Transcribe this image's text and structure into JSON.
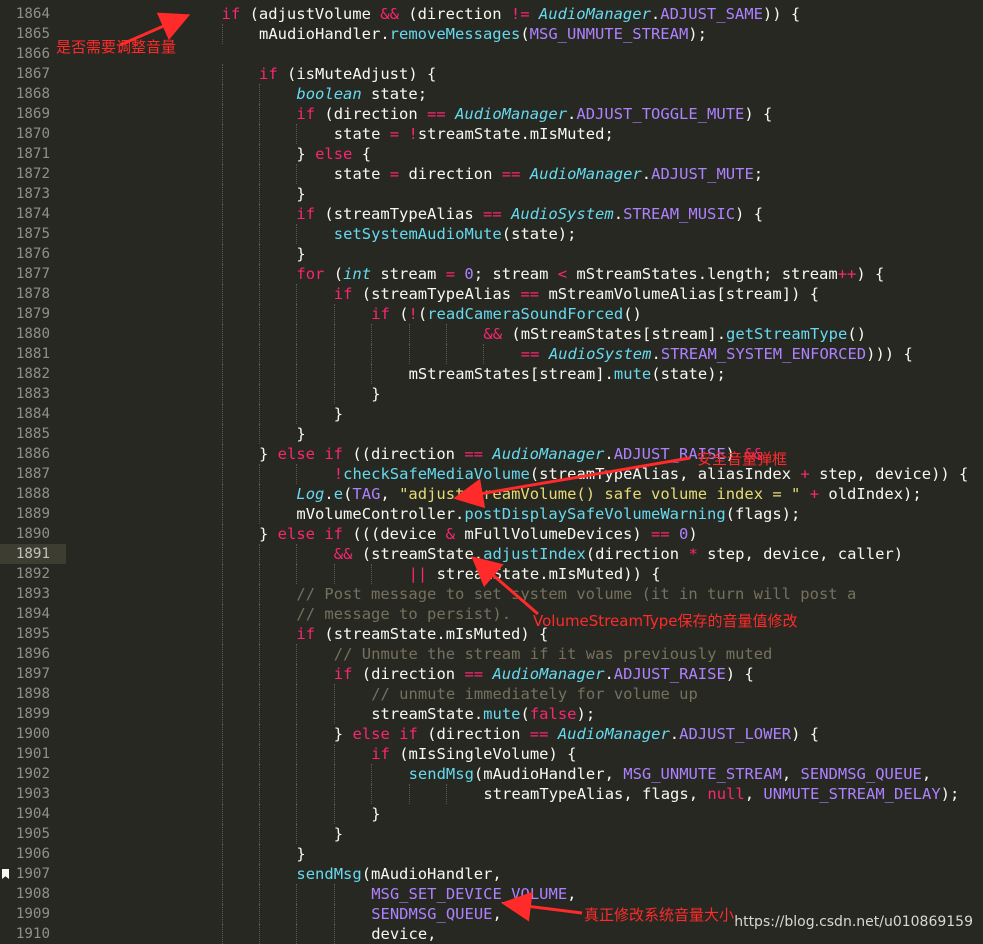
{
  "editor": {
    "theme_colors": {
      "background": "#272822",
      "keyword": "#f92672",
      "type": "#66d9ef",
      "constant": "#ae81ff",
      "string": "#e6db74",
      "comment": "#75715e",
      "annotation": "#ff2a2a"
    },
    "lines": [
      {
        "n": "1864",
        "indent": 4,
        "code": "if (adjustVolume && (direction != AudioManager.ADJUST_SAME)) {"
      },
      {
        "n": "1865",
        "indent": 5,
        "code": "mAudioHandler.removeMessages(MSG_UNMUTE_STREAM);"
      },
      {
        "n": "1866",
        "indent": 0,
        "code": ""
      },
      {
        "n": "1867",
        "indent": 5,
        "code": "if (isMuteAdjust) {"
      },
      {
        "n": "1868",
        "indent": 6,
        "code": "boolean state;"
      },
      {
        "n": "1869",
        "indent": 6,
        "code": "if (direction == AudioManager.ADJUST_TOGGLE_MUTE) {"
      },
      {
        "n": "1870",
        "indent": 7,
        "code": "state = !streamState.mIsMuted;"
      },
      {
        "n": "1871",
        "indent": 6,
        "code": "} else {"
      },
      {
        "n": "1872",
        "indent": 7,
        "code": "state = direction == AudioManager.ADJUST_MUTE;"
      },
      {
        "n": "1873",
        "indent": 6,
        "code": "}"
      },
      {
        "n": "1874",
        "indent": 6,
        "code": "if (streamTypeAlias == AudioSystem.STREAM_MUSIC) {"
      },
      {
        "n": "1875",
        "indent": 7,
        "code": "setSystemAudioMute(state);"
      },
      {
        "n": "1876",
        "indent": 6,
        "code": "}"
      },
      {
        "n": "1877",
        "indent": 6,
        "code": "for (int stream = 0; stream < mStreamStates.length; stream++) {"
      },
      {
        "n": "1878",
        "indent": 7,
        "code": "if (streamTypeAlias == mStreamVolumeAlias[stream]) {"
      },
      {
        "n": "1879",
        "indent": 8,
        "code": "if (!(readCameraSoundForced()"
      },
      {
        "n": "1880",
        "indent": 11,
        "code": "&& (mStreamStates[stream].getStreamType()"
      },
      {
        "n": "1881",
        "indent": 12,
        "code": "== AudioSystem.STREAM_SYSTEM_ENFORCED))) {"
      },
      {
        "n": "1882",
        "indent": 9,
        "code": "mStreamStates[stream].mute(state);"
      },
      {
        "n": "1883",
        "indent": 8,
        "code": "}"
      },
      {
        "n": "1884",
        "indent": 7,
        "code": "}"
      },
      {
        "n": "1885",
        "indent": 6,
        "code": "}"
      },
      {
        "n": "1886",
        "indent": 5,
        "code": "} else if ((direction == AudioManager.ADJUST_RAISE) &&"
      },
      {
        "n": "1887",
        "indent": 7,
        "code": "!checkSafeMediaVolume(streamTypeAlias, aliasIndex + step, device)) {"
      },
      {
        "n": "1888",
        "indent": 6,
        "code": "Log.e(TAG, \"adjustStreamVolume() safe volume index = \" + oldIndex);"
      },
      {
        "n": "1889",
        "indent": 6,
        "code": "mVolumeController.postDisplaySafeVolumeWarning(flags);"
      },
      {
        "n": "1890",
        "indent": 5,
        "code": "} else if (((device & mFullVolumeDevices) == 0)"
      },
      {
        "n": "1891",
        "indent": 7,
        "code": "&& (streamState.adjustIndex(direction * step, device, caller)"
      },
      {
        "n": "1892",
        "indent": 9,
        "code": "|| streamState.mIsMuted)) {"
      },
      {
        "n": "1893",
        "indent": 6,
        "code": "// Post message to set system volume (it in turn will post a"
      },
      {
        "n": "1894",
        "indent": 6,
        "code": "// message to persist)."
      },
      {
        "n": "1895",
        "indent": 6,
        "code": "if (streamState.mIsMuted) {"
      },
      {
        "n": "1896",
        "indent": 7,
        "code": "// Unmute the stream if it was previously muted"
      },
      {
        "n": "1897",
        "indent": 7,
        "code": "if (direction == AudioManager.ADJUST_RAISE) {"
      },
      {
        "n": "1898",
        "indent": 8,
        "code": "// unmute immediately for volume up"
      },
      {
        "n": "1899",
        "indent": 8,
        "code": "streamState.mute(false);"
      },
      {
        "n": "1900",
        "indent": 7,
        "code": "} else if (direction == AudioManager.ADJUST_LOWER) {"
      },
      {
        "n": "1901",
        "indent": 8,
        "code": "if (mIsSingleVolume) {"
      },
      {
        "n": "1902",
        "indent": 9,
        "code": "sendMsg(mAudioHandler, MSG_UNMUTE_STREAM, SENDMSG_QUEUE,"
      },
      {
        "n": "1903",
        "indent": 11,
        "code": "streamTypeAlias, flags, null, UNMUTE_STREAM_DELAY);"
      },
      {
        "n": "1904",
        "indent": 8,
        "code": "}"
      },
      {
        "n": "1905",
        "indent": 7,
        "code": "}"
      },
      {
        "n": "1906",
        "indent": 6,
        "code": "}"
      },
      {
        "n": "1907",
        "indent": 6,
        "code": "sendMsg(mAudioHandler,"
      },
      {
        "n": "1908",
        "indent": 8,
        "code": "MSG_SET_DEVICE_VOLUME,"
      },
      {
        "n": "1909",
        "indent": 8,
        "code": "SENDMSG_QUEUE,"
      },
      {
        "n": "1910",
        "indent": 8,
        "code": "device,"
      }
    ],
    "highlighted_line": "1891",
    "bookmark_line": "1907"
  },
  "annotations": {
    "adjust_needed": "是否需要调整音量",
    "safe_volume": "安全音量弹框",
    "stream_index": "VolumeStreamType保存的音量值修改",
    "set_volume": "真正修改系统音量大小"
  },
  "watermark": "https://blog.csdn.net/u010869159"
}
